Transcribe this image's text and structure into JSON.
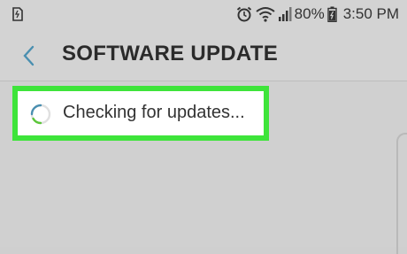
{
  "status_bar": {
    "battery_percent": "80%",
    "time": "3:50 PM",
    "icons": [
      "sim-icon",
      "alarm-icon",
      "wifi-icon",
      "signal-icon",
      "battery-icon"
    ]
  },
  "header": {
    "title": "SOFTWARE UPDATE",
    "back_icon": "chevron-left-icon"
  },
  "main": {
    "status_text": "Checking for updates...",
    "spinner_icon": "loading-spinner-icon",
    "highlight_color": "#3ee43a",
    "accent_color": "#4a8fb0"
  }
}
